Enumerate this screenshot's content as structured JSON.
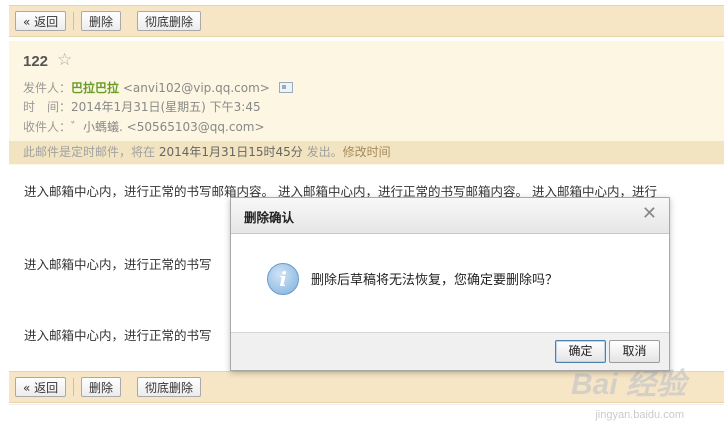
{
  "toolbar": {
    "back_label": "« 返回",
    "delete_label": "删除",
    "delete_permanently_label": "彻底删除"
  },
  "mail": {
    "subject": "122",
    "star_icon": "star-icon",
    "from_label": "发件人：",
    "from_name": "巴拉巴拉",
    "from_address": "<anvi102@vip.qq.com>",
    "time_label": "时　间：",
    "time_value": "2014年1月31日(星期五) 下午3:45",
    "to_label": "收件人：",
    "to_name": "゛小螞蟻.",
    "to_address": "<50565103@qq.com>"
  },
  "notice": {
    "prefix": "此邮件是定时邮件，将在 ",
    "datetime": "2014年1月31日15时45分",
    "suffix": " 发出。",
    "link": "修改时间"
  },
  "body": {
    "line1": "进入邮箱中心内，进行正常的书写邮箱内容。 进入邮箱中心内，进行正常的书写邮箱内容。 进入邮箱中心内，进行",
    "line2": "进入邮箱中心内，进行正常的书写",
    "line3": "进入邮箱中心内，进行正常的书写"
  },
  "dialog": {
    "title": "删除确认",
    "close_icon": "close-icon",
    "info_icon": "info-icon",
    "info_glyph": "i",
    "message": "删除后草稿将无法恢复，您确定要删除吗？",
    "confirm_label": "确定",
    "cancel_label": "取消"
  },
  "watermark": {
    "brand": "Bai  经验",
    "url": "jingyan.baidu.com"
  },
  "colors": {
    "toolbar_bg": "#f7e6c5",
    "header_bg": "#fdf6e3",
    "sender_name": "#6b9c2a"
  }
}
